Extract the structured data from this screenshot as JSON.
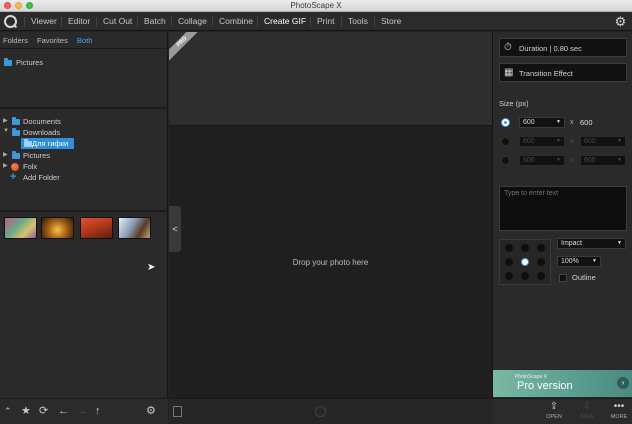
{
  "window": {
    "title": "PhotoScape X"
  },
  "menu": {
    "items": [
      "Viewer",
      "Editor",
      "Cut Out",
      "Batch",
      "Collage",
      "Combine",
      "Create GIF",
      "Print",
      "Tools",
      "Store"
    ],
    "active": "Create GIF"
  },
  "left_panel": {
    "tabs": [
      "Folders",
      "Favorites",
      "Both"
    ],
    "active_tab": "Both",
    "favorites": [
      "Pictures"
    ],
    "tree": [
      {
        "label": "Documents"
      },
      {
        "label": "Downloads"
      },
      {
        "label": "Для гифки",
        "selected": true
      },
      {
        "label": "Pictures"
      },
      {
        "label": "Folx"
      },
      {
        "label": "Add Folder"
      }
    ]
  },
  "center": {
    "pro_badge": "PRO",
    "drop_hint": "Drop your photo here"
  },
  "right_panel": {
    "duration_label": "Duration | 0.80 sec",
    "transition_label": "Transition Effect",
    "size_label": "Size (px)",
    "size_rows": [
      {
        "width": "600",
        "height": "600",
        "selected": true
      },
      {
        "width": "600",
        "height": "600",
        "selected": false
      },
      {
        "width": "600",
        "height": "600",
        "selected": false
      }
    ],
    "x_symbol": "x",
    "text_placeholder": "Type to enter text",
    "font": "Impact",
    "zoom": "100%",
    "outline_label": "Outline",
    "pro_banner": {
      "brand": "PhotoScape X",
      "title": "Pro version"
    }
  },
  "bottom_right": {
    "open_label": "OPEN",
    "save_label": "SAVE",
    "more_label": "MORE"
  },
  "colors": {
    "accent": "#3b9ad9",
    "selection": "#2d8fdd",
    "banner": "#6aac9a"
  }
}
